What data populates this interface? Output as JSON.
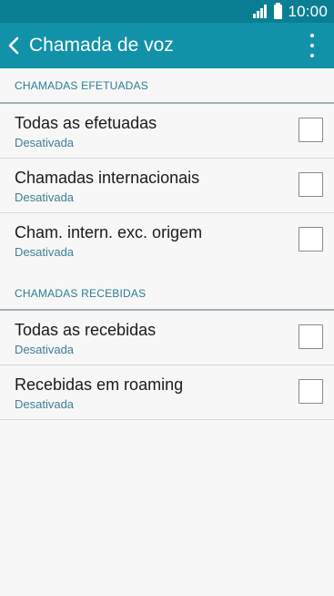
{
  "status_bar": {
    "time": "10:00",
    "signal_icon": "signal-icon",
    "battery_icon": "battery-icon"
  },
  "app_bar": {
    "title": "Chamada de voz",
    "back_icon": "chevron-left-icon",
    "menu_icon": "more-vertical-icon"
  },
  "sections": [
    {
      "header": "CHAMADAS EFETUADAS",
      "items": [
        {
          "title": "Todas as efetuadas",
          "subtitle": "Desativada",
          "checked": false
        },
        {
          "title": "Chamadas internacionais",
          "subtitle": "Desativada",
          "checked": false
        },
        {
          "title": "Cham. intern. exc. origem",
          "subtitle": "Desativada",
          "checked": false
        }
      ]
    },
    {
      "header": "CHAMADAS RECEBIDAS",
      "items": [
        {
          "title": "Todas as recebidas",
          "subtitle": "Desativada",
          "checked": false
        },
        {
          "title": "Recebidas em roaming",
          "subtitle": "Desativada",
          "checked": false
        }
      ]
    }
  ],
  "colors": {
    "status_bar": "#0a7f93",
    "app_bar": "#1292a8",
    "background": "#f7f7f7",
    "section_header_text": "#2c7d95",
    "subtitle_text": "#3f7f93"
  }
}
